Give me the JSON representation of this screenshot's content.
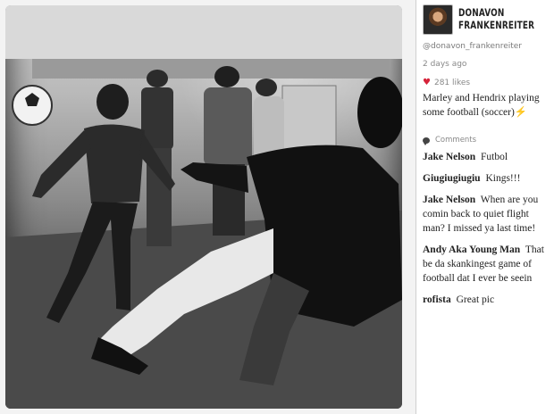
{
  "post": {
    "author_name_line1": "DONAVON",
    "author_name_line2": "FRANKENREITER",
    "handle": "@donavon_frankenreiter",
    "posted_ago": "2 days ago",
    "likes": "281 likes",
    "caption": "Marley and Hendrix playing some football (soccer)⚡"
  },
  "comments": {
    "heading": "Comments",
    "items": [
      {
        "user": "Jake Nelson",
        "text": "Futbol"
      },
      {
        "user": "Giugiugiugiu",
        "text": "Kings!!!"
      },
      {
        "user": "Jake Nelson",
        "text": "When are you comin back to quiet flight man? I missed ya last time!"
      },
      {
        "user": "Andy Aka Young Man",
        "text": "That be da skankingest game of football dat I ever be seein"
      },
      {
        "user": "rofista",
        "text": "Great pic"
      }
    ]
  },
  "icons": {
    "heart": "heart-icon",
    "comments": "comment-bubble-icon",
    "avatar": "avatar"
  },
  "colors": {
    "heart": "#d6233a",
    "text": "#222222",
    "muted": "#888888"
  }
}
